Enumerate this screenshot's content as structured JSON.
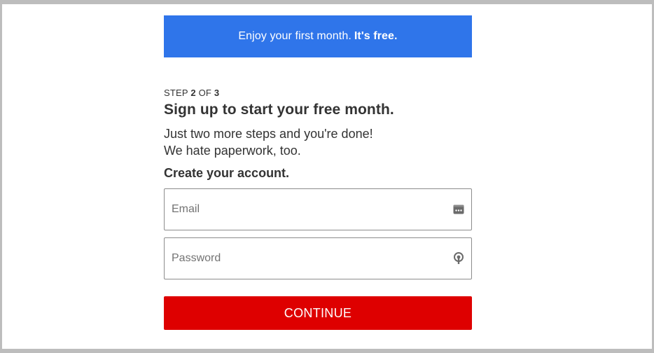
{
  "banner": {
    "text": "Enjoy your first month.",
    "strong": "It's free."
  },
  "step": {
    "prefix": "STEP",
    "current": "2",
    "of": "OF",
    "total": "3"
  },
  "title": "Sign up to start your free month.",
  "subtitle": {
    "line1": "Just two more steps and you're done!",
    "line2": "We hate paperwork, too."
  },
  "section_heading": "Create your account.",
  "form": {
    "email_placeholder": "Email",
    "password_placeholder": "Password",
    "email_icon": "password-manager-dots-icon",
    "password_icon": "key-manager-icon"
  },
  "continue_label": "CONTINUE",
  "colors": {
    "banner": "#2f75ea",
    "button": "#de0000"
  }
}
